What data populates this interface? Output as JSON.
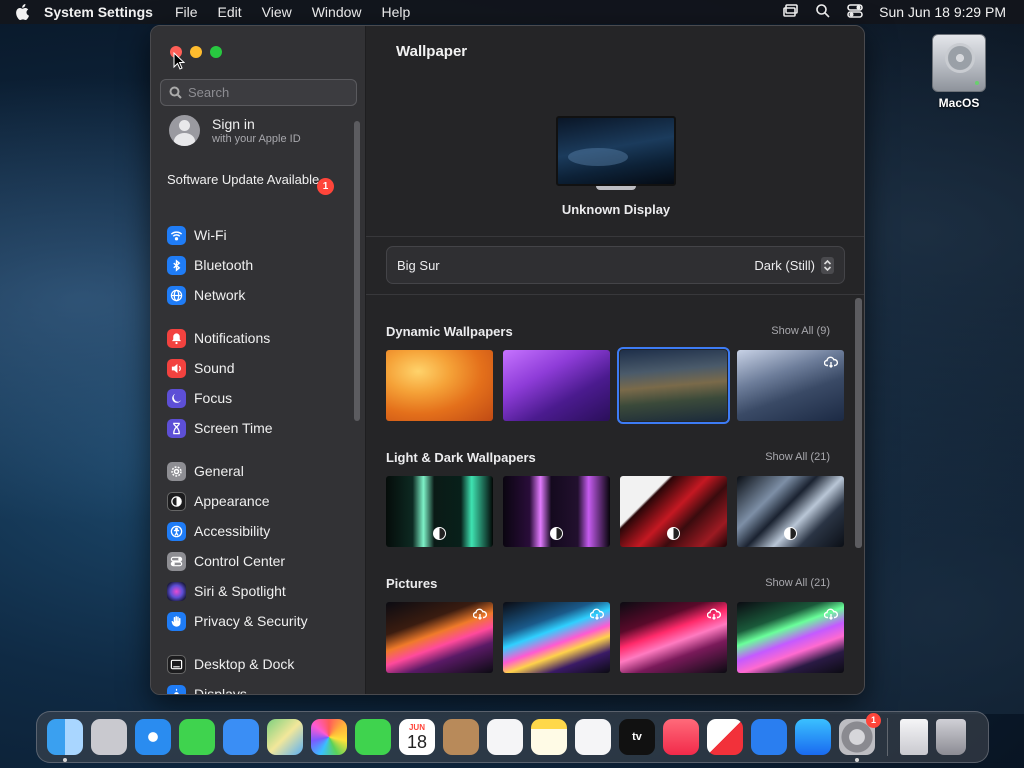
{
  "menubar": {
    "app_name": "System Settings",
    "menus": [
      "File",
      "Edit",
      "View",
      "Window",
      "Help"
    ],
    "clock": "Sun Jun 18  9:29 PM"
  },
  "desktop": {
    "drive_label": "MacOS"
  },
  "sidebar": {
    "search_placeholder": "Search",
    "signin_title": "Sign in",
    "signin_subtitle": "with your Apple ID",
    "update_label": "Software Update Available",
    "update_badge": "1",
    "group1": [
      {
        "label": "Wi-Fi",
        "color": "#1f7cf6",
        "icon": "wifi-icon"
      },
      {
        "label": "Bluetooth",
        "color": "#1f7cf6",
        "icon": "bluetooth-icon"
      },
      {
        "label": "Network",
        "color": "#1f7cf6",
        "icon": "globe-icon"
      }
    ],
    "group2": [
      {
        "label": "Notifications",
        "color": "#f2423f",
        "icon": "bell-icon"
      },
      {
        "label": "Sound",
        "color": "#f2423f",
        "icon": "speaker-icon"
      },
      {
        "label": "Focus",
        "color": "#5d4fd6",
        "icon": "moon-icon"
      },
      {
        "label": "Screen Time",
        "color": "#5d4fd6",
        "icon": "hourglass-icon"
      }
    ],
    "group3": [
      {
        "label": "General",
        "color": "#8e8e93",
        "icon": "gear-icon"
      },
      {
        "label": "Appearance",
        "color": "#1c1c1e",
        "icon": "appearance-icon"
      },
      {
        "label": "Accessibility",
        "color": "#1f7cf6",
        "icon": "accessibility-icon"
      },
      {
        "label": "Control Center",
        "color": "#8e8e93",
        "icon": "toggles-icon"
      },
      {
        "label": "Siri & Spotlight",
        "color": "#2b2b60",
        "icon": "siri-icon"
      },
      {
        "label": "Privacy & Security",
        "color": "#1f7cf6",
        "icon": "hand-icon"
      }
    ],
    "group4": [
      {
        "label": "Desktop & Dock",
        "color": "#1c1c1e",
        "icon": "dock-icon"
      },
      {
        "label": "Displays",
        "color": "#1f7cf6",
        "icon": "display-icon"
      }
    ]
  },
  "content": {
    "title": "Wallpaper",
    "display_name": "Unknown Display",
    "wallpaper_name": "Big Sur",
    "wallpaper_mode": "Dark (Still)",
    "sections": [
      {
        "title": "Dynamic Wallpapers",
        "show_all": "Show All (9)"
      },
      {
        "title": "Light & Dark Wallpapers",
        "show_all": "Show All (21)"
      },
      {
        "title": "Pictures",
        "show_all": "Show All (21)"
      }
    ]
  },
  "dock": {
    "settings_badge": "1",
    "calendar_month": "JUN",
    "calendar_day": "18",
    "tv_label": "tv"
  }
}
